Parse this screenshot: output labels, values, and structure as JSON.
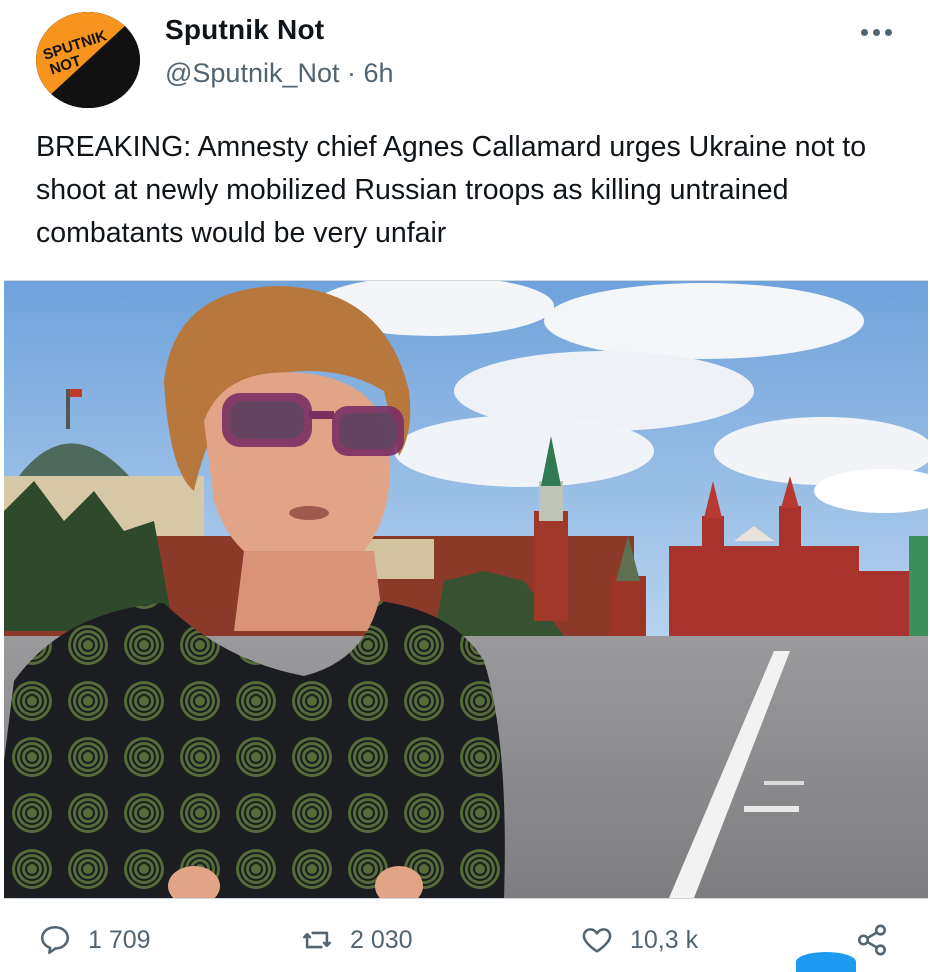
{
  "account": {
    "name": "Sputnik Not",
    "handle": "@Sputnik_Not",
    "separator": "·",
    "time": "6h",
    "avatar_text_line1": "SPUTNIK",
    "avatar_text_line2": "NOT"
  },
  "tweet": {
    "text": "BREAKING: Amnesty chief Agnes Callamard urges Ukraine not to shoot at newly mobilized Russian troops as killing untrained combatants would be very unfair"
  },
  "actions": {
    "replies": "1 709",
    "retweets": "2 030",
    "likes": "10,3 k"
  },
  "icons": {
    "more": "more-dots-icon",
    "reply": "reply-icon",
    "retweet": "retweet-icon",
    "like": "heart-icon",
    "share": "share-icon"
  },
  "colors": {
    "text": "#0f1419",
    "secondary": "#536471",
    "accent": "#1d9bf0",
    "avatar_orange": "#f7941d"
  }
}
